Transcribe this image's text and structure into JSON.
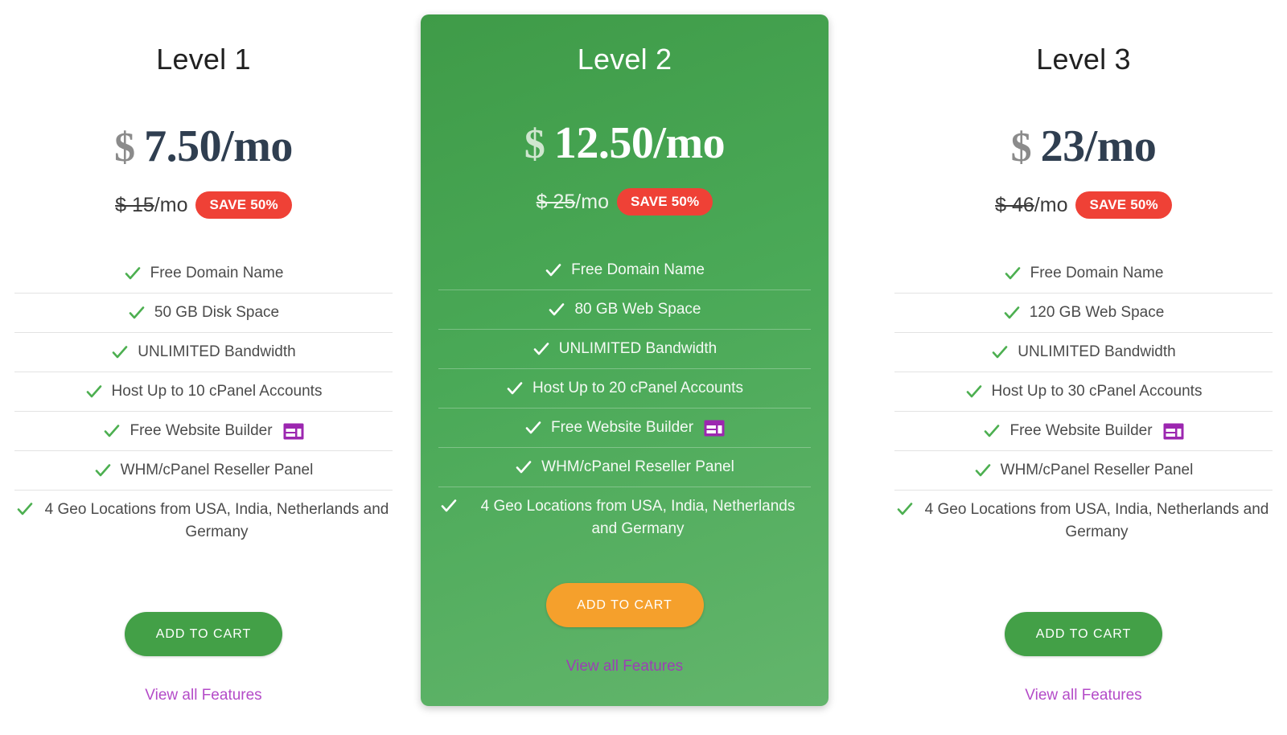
{
  "page": {
    "background": "#ffffff",
    "accent_green": "#43a047",
    "accent_orange": "#f5a02c",
    "badge_red": "#ef4136",
    "link_purple": "#b44bc8",
    "price_navy": "#2f3e50",
    "currency_gray": "#8b8b8b"
  },
  "plans": [
    {
      "title": "Level 1",
      "currency": "$",
      "price": "7.50/mo",
      "old_price_struck": "$ 15",
      "old_price_suffix": "/mo",
      "save_badge": "SAVE 50%",
      "features": [
        "Free Domain Name",
        "50 GB Disk Space",
        "UNLIMITED Bandwidth",
        "Host Up to 10 cPanel Accounts",
        "Free Website Builder",
        "WHM/cPanel Reseller Panel",
        "4 Geo Locations from USA, India, Netherlands and Germany"
      ],
      "cta_label": "ADD TO CART",
      "view_all_label": "View all Features"
    },
    {
      "title": "Level 2",
      "currency": "$",
      "price": "12.50/mo",
      "old_price_struck": "$ 25",
      "old_price_suffix": "/mo",
      "save_badge": "SAVE 50%",
      "features": [
        "Free Domain Name",
        "80 GB Web Space",
        "UNLIMITED Bandwidth",
        "Host Up to 20 cPanel Accounts",
        "Free Website Builder",
        "WHM/cPanel Reseller Panel",
        "4 Geo Locations from USA, India, Netherlands and Germany"
      ],
      "cta_label": "ADD TO CART",
      "view_all_label": "View all Features"
    },
    {
      "title": "Level 3",
      "currency": "$",
      "price": "23/mo",
      "old_price_struck": "$ 46",
      "old_price_suffix": "/mo",
      "save_badge": "SAVE 50%",
      "features": [
        "Free Domain Name",
        "120 GB Web Space",
        "UNLIMITED Bandwidth",
        "Host Up to 30 cPanel Accounts",
        "Free Website Builder",
        "WHM/cPanel Reseller Panel",
        "4 Geo Locations from USA, India, Netherlands and Germany"
      ],
      "cta_label": "ADD TO CART",
      "view_all_label": "View all Features"
    }
  ],
  "icons": {
    "check": "check-icon",
    "website_builder": "website-builder-icon"
  }
}
